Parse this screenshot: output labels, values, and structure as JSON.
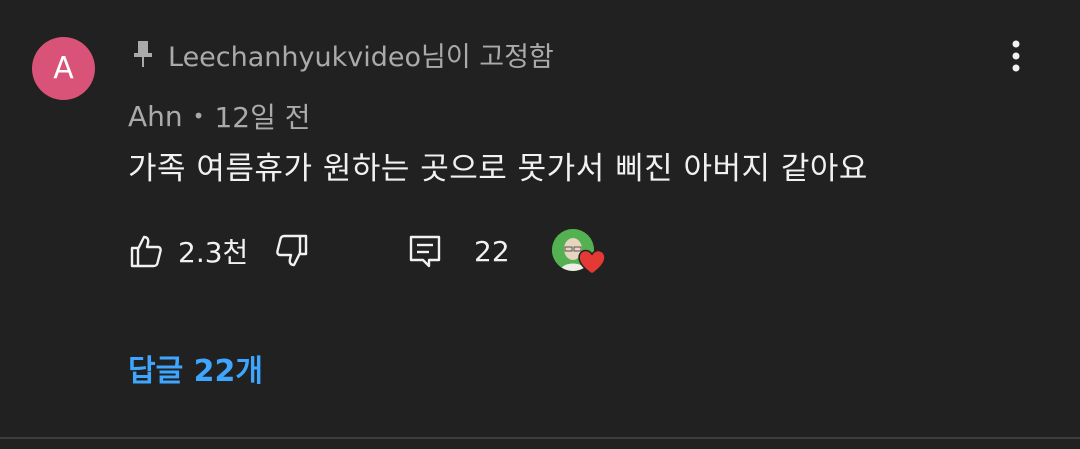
{
  "comment": {
    "avatar_letter": "A",
    "avatar_color": "#d95378",
    "pinned_text": "Leechanhyukvideo님이 고정함",
    "author": "Ahn",
    "separator": "•",
    "timestamp": "12일 전",
    "text": "가족 여름휴가 원하는 곳으로 못가서 삐진 아버지 같아요",
    "like_count": "2.3천",
    "reply_count": "22",
    "view_replies_label": "답글 22개",
    "link_color": "#3ea6ff"
  },
  "icons": {
    "pin": "pin-icon",
    "more": "more-vertical-icon",
    "like": "thumbs-up-icon",
    "dislike": "thumbs-down-icon",
    "reply": "reply-comment-icon",
    "heart": "creator-heart-icon"
  }
}
